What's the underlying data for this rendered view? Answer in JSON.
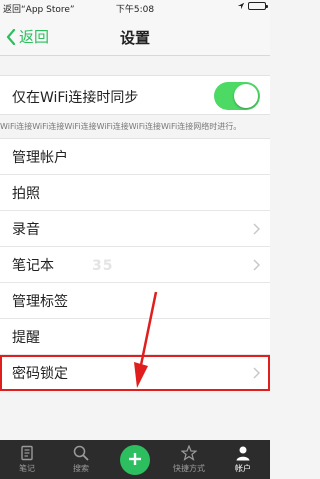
{
  "status_bar": {
    "back_app": "返回“App Store”",
    "time": "下午5:08",
    "battery_icon": "battery-full-icon",
    "location_icon": "location-icon"
  },
  "nav": {
    "back_label": "返回",
    "title": "设置",
    "accent_color": "#2dbe60"
  },
  "sync": {
    "label": "仅在WiFi连接时同步",
    "toggle_on": true,
    "description": "WiFi连接WiFi连接WiFi连接WiFi连接WiFi连接WiFi连接网络时进行。"
  },
  "menu": {
    "items": [
      {
        "label": "管理帐户",
        "chevron": false
      },
      {
        "label": "拍照",
        "chevron": false
      },
      {
        "label": "录音",
        "chevron": true
      },
      {
        "label": "笔记本",
        "chevron": true
      },
      {
        "label": "管理标签",
        "chevron": false
      },
      {
        "label": "提醒",
        "chevron": false
      },
      {
        "label": "密码锁定",
        "chevron": true,
        "highlighted": true
      }
    ]
  },
  "watermark": "35",
  "tabbar": {
    "tabs": [
      {
        "label": "笔记",
        "icon": "notes-icon"
      },
      {
        "label": "搜索",
        "icon": "search-icon"
      },
      {
        "label": "",
        "icon": "add-icon"
      },
      {
        "label": "快捷方式",
        "icon": "star-icon"
      },
      {
        "label": "帐户",
        "icon": "account-icon",
        "active": true
      }
    ]
  },
  "highlight_color": "#e01e1e"
}
